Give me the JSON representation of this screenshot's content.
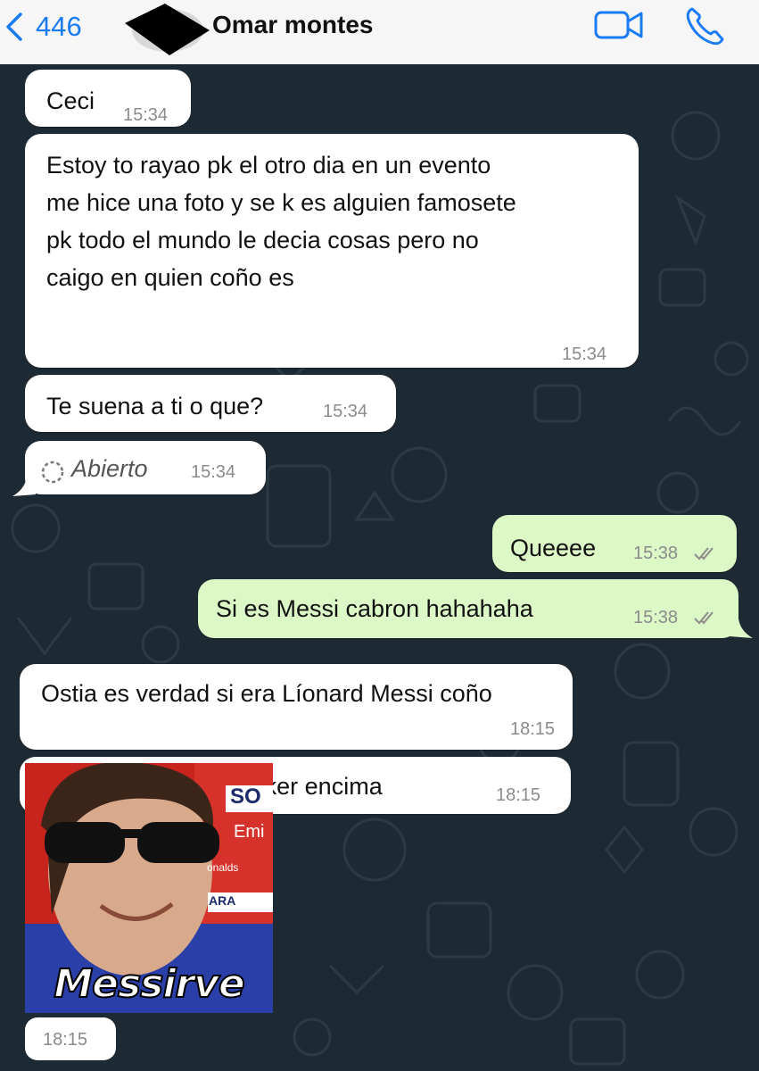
{
  "header": {
    "back_count": "446",
    "contact_name": "Omar montes",
    "icons": {
      "back": "chevron-left-icon",
      "video": "video-camera-icon",
      "call": "phone-icon"
    },
    "accent_color": "#1a7cf5"
  },
  "messages": [
    {
      "direction": "incoming",
      "lines": [
        "Ceci"
      ],
      "time": "15:34"
    },
    {
      "direction": "incoming",
      "lines": [
        "Estoy to rayao pk el otro dia en un evento",
        "me hice una foto y se k es alguien famosete",
        "pk todo el mundo le decia cosas pero no",
        "caigo en quien coño es"
      ],
      "time": "15:34"
    },
    {
      "direction": "incoming",
      "lines": [
        "Te suena a ti o que?"
      ],
      "time": "15:34"
    },
    {
      "direction": "incoming",
      "lines": [
        "Abierto"
      ],
      "time": "15:34",
      "type": "view-once-opened"
    },
    {
      "direction": "outgoing",
      "lines": [
        "Queeee"
      ],
      "time": "15:38",
      "status": "read"
    },
    {
      "direction": "outgoing",
      "lines": [
        "Si es Messi cabron hahahaha"
      ],
      "time": "15:38",
      "status": "read"
    },
    {
      "direction": "incoming",
      "lines": [
        "Ostia es verdad si era Líonard Messi coño"
      ],
      "time": "18:15"
    },
    {
      "direction": "incoming",
      "lines": [
        "Si lo tengo en un sticker encima"
      ],
      "time": "18:15"
    },
    {
      "direction": "incoming",
      "type": "sticker",
      "caption": "Messirve",
      "background_text": [
        "SO",
        "Emi",
        "onalds",
        "ARA"
      ],
      "time": "18:15"
    }
  ],
  "colors": {
    "incoming": "#ffffff",
    "outgoing": "#dcf8c6",
    "chat_background": "#1e2a33"
  }
}
